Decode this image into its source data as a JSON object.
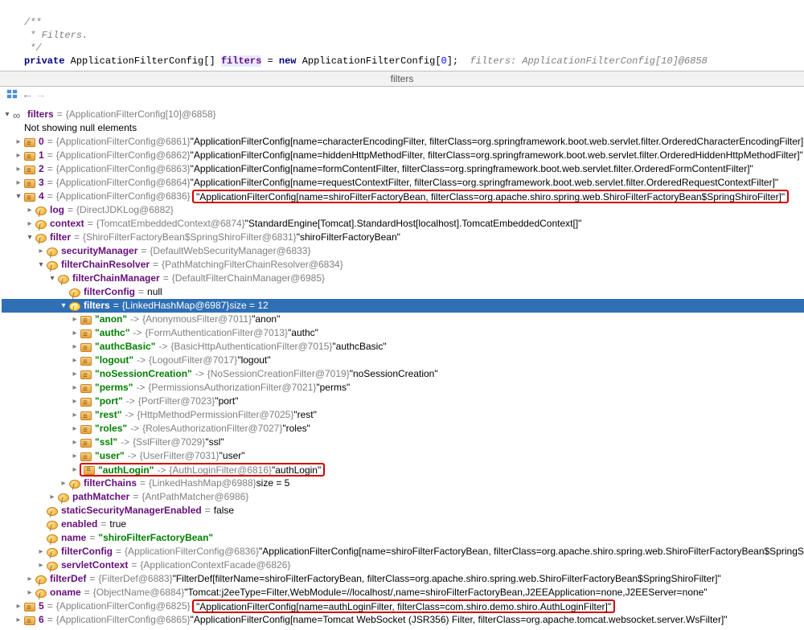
{
  "code": {
    "c1": "/**",
    "c2": " * Filters.",
    "c3": " */",
    "kw_private": "private",
    "type": "ApplicationFilterConfig[]",
    "var": "filters",
    "eq": " = ",
    "kw_new": "new",
    "ctor": " ApplicationFilterConfig[",
    "zero": "0",
    "close": "];",
    "hint": "  filters: ApplicationFilterConfig[10]@6858"
  },
  "tab": "filters",
  "tree": {
    "root_name": "filters",
    "root_eq": " = ",
    "root_ref": "{ApplicationFilterConfig[10]@6858}",
    "not_showing": "Not showing null elements",
    "r0_idx": "0",
    "r0_eq": " = ",
    "r0_ref": "{ApplicationFilterConfig@6861}",
    "r0_val": " \"ApplicationFilterConfig[name=characterEncodingFilter, filterClass=org.springframework.boot.web.servlet.filter.OrderedCharacterEncodingFilter]\"",
    "r1_idx": "1",
    "r1_ref": "{ApplicationFilterConfig@6862}",
    "r1_val": " \"ApplicationFilterConfig[name=hiddenHttpMethodFilter, filterClass=org.springframework.boot.web.servlet.filter.OrderedHiddenHttpMethodFilter]\"",
    "r2_idx": "2",
    "r2_ref": "{ApplicationFilterConfig@6863}",
    "r2_val": " \"ApplicationFilterConfig[name=formContentFilter, filterClass=org.springframework.boot.web.servlet.filter.OrderedFormContentFilter]\"",
    "r3_idx": "3",
    "r3_ref": "{ApplicationFilterConfig@6864}",
    "r3_val": " \"ApplicationFilterConfig[name=requestContextFilter, filterClass=org.springframework.boot.web.servlet.filter.OrderedRequestContextFilter]\"",
    "r4_idx": "4",
    "r4_ref": "{ApplicationFilterConfig@6836}",
    "r4_val": "\"ApplicationFilterConfig[name=shiroFilterFactoryBean, filterClass=org.apache.shiro.spring.web.ShiroFilterFactoryBean$SpringShiroFilter]\"",
    "log_name": "log",
    "log_ref": "{DirectJDKLog@6882}",
    "ctx_name": "context",
    "ctx_ref": "{TomcatEmbeddedContext@6874}",
    "ctx_val": " \"StandardEngine[Tomcat].StandardHost[localhost].TomcatEmbeddedContext[]\"",
    "flt_name": "filter",
    "flt_ref": "{ShiroFilterFactoryBean$SpringShiroFilter@6831}",
    "flt_val": " \"shiroFilterFactoryBean\"",
    "sm_name": "securityManager",
    "sm_ref": "{DefaultWebSecurityManager@6833}",
    "fcr_name": "filterChainResolver",
    "fcr_ref": "{PathMatchingFilterChainResolver@6834}",
    "fcm_name": "filterChainManager",
    "fcm_ref": "{DefaultFilterChainManager@6985}",
    "fcfg_name": "filterConfig",
    "fcfg_val": " null",
    "filters_name": "filters",
    "filters_ref": "{LinkedHashMap@6987} ",
    "filters_size": " size = 12",
    "map": [
      {
        "k": "\"anon\"",
        "ref": "{AnonymousFilter@7011}",
        "v": " \"anon\""
      },
      {
        "k": "\"authc\"",
        "ref": "{FormAuthenticationFilter@7013}",
        "v": " \"authc\""
      },
      {
        "k": "\"authcBasic\"",
        "ref": "{BasicHttpAuthenticationFilter@7015}",
        "v": " \"authcBasic\""
      },
      {
        "k": "\"logout\"",
        "ref": "{LogoutFilter@7017}",
        "v": " \"logout\""
      },
      {
        "k": "\"noSessionCreation\"",
        "ref": "{NoSessionCreationFilter@7019}",
        "v": " \"noSessionCreation\""
      },
      {
        "k": "\"perms\"",
        "ref": "{PermissionsAuthorizationFilter@7021}",
        "v": " \"perms\""
      },
      {
        "k": "\"port\"",
        "ref": "{PortFilter@7023}",
        "v": " \"port\""
      },
      {
        "k": "\"rest\"",
        "ref": "{HttpMethodPermissionFilter@7025}",
        "v": " \"rest\""
      },
      {
        "k": "\"roles\"",
        "ref": "{RolesAuthorizationFilter@7027}",
        "v": " \"roles\""
      },
      {
        "k": "\"ssl\"",
        "ref": "{SslFilter@7029}",
        "v": " \"ssl\""
      },
      {
        "k": "\"user\"",
        "ref": "{UserFilter@7031}",
        "v": " \"user\""
      },
      {
        "k": "\"authLogin\"",
        "ref": "{AuthLoginFilter@6816}",
        "v": " \"authLogin\""
      }
    ],
    "fchains_name": "filterChains",
    "fchains_ref": "{LinkedHashMap@6988} ",
    "fchains_size": " size = 5",
    "pm_name": "pathMatcher",
    "pm_ref": "{AntPathMatcher@6986}",
    "ssme_name": "staticSecurityManagerEnabled",
    "ssme_val": " false",
    "en_name": "enabled",
    "en_val": " true",
    "nm_name": "name",
    "nm_val": "\"shiroFilterFactoryBean\"",
    "fc2_name": "filterConfig",
    "fc2_ref": "{ApplicationFilterConfig@6836}",
    "fc2_val": " \"ApplicationFilterConfig[name=shiroFilterFactoryBean, filterClass=org.apache.shiro.spring.web.ShiroFilterFactoryBean$SpringShiroFilter]\"",
    "sc_name": "servletContext",
    "sc_ref": "{ApplicationContextFacade@6826}",
    "fd_name": "filterDef",
    "fd_ref": "{FilterDef@6883}",
    "fd_val": " \"FilterDef[filterName=shiroFilterFactoryBean, filterClass=org.apache.shiro.spring.web.ShiroFilterFactoryBean$SpringShiroFilter]\"",
    "on_name": "oname",
    "on_ref": "{ObjectName@6884}",
    "on_val": " \"Tomcat:j2eeType=Filter,WebModule=//localhost/,name=shiroFilterFactoryBean,J2EEApplication=none,J2EEServer=none\"",
    "r5_idx": "5",
    "r5_ref": "{ApplicationFilterConfig@6825}",
    "r5_val": "\"ApplicationFilterConfig[name=authLoginFilter, filterClass=com.shiro.demo.shiro.AuthLoginFilter]\"",
    "r6_idx": "6",
    "r6_ref": "{ApplicationFilterConfig@6865}",
    "r6_val": " \"ApplicationFilterConfig[name=Tomcat WebSocket (JSR356) Filter, filterClass=org.apache.tomcat.websocket.server.WsFilter]\""
  }
}
